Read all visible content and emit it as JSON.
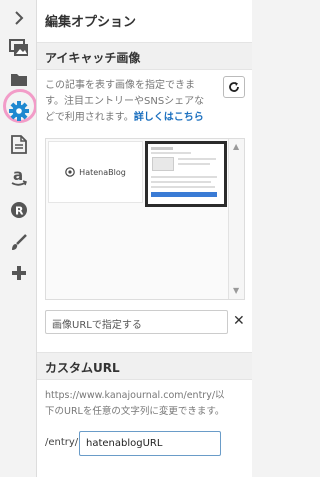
{
  "rail": {
    "items": [
      {
        "name": "expand-chevron-icon"
      },
      {
        "name": "image-icon"
      },
      {
        "name": "folder-icon"
      },
      {
        "name": "gear-icon",
        "active": true
      },
      {
        "name": "document-icon"
      },
      {
        "name": "amazon-icon"
      },
      {
        "name": "rakuten-icon"
      },
      {
        "name": "brush-icon"
      },
      {
        "name": "plus-icon"
      }
    ],
    "highlight_color": "#f29cc8",
    "active_color": "#1e88d0"
  },
  "panel": {
    "title": "編集オプション"
  },
  "eyecatch": {
    "heading": "アイキャッチ画像",
    "desc_line1": "この記事を表す画像を指定できま",
    "desc_line2": "す。注目エントリーやSNSシェアな",
    "desc_line3": "どで利用されます。",
    "details_link": "詳しくはこちら",
    "thumb_logo": "HatenaBlog",
    "url_input_value": "画像URLで指定する"
  },
  "custom_url": {
    "heading": "カスタムURL",
    "desc_line1": "https://www.kanajournal.com/entry/以",
    "desc_line2": "下のURLを任意の文字列に変更できます。",
    "prefix": "/entry/",
    "slug_value": "hatenablogURL"
  }
}
